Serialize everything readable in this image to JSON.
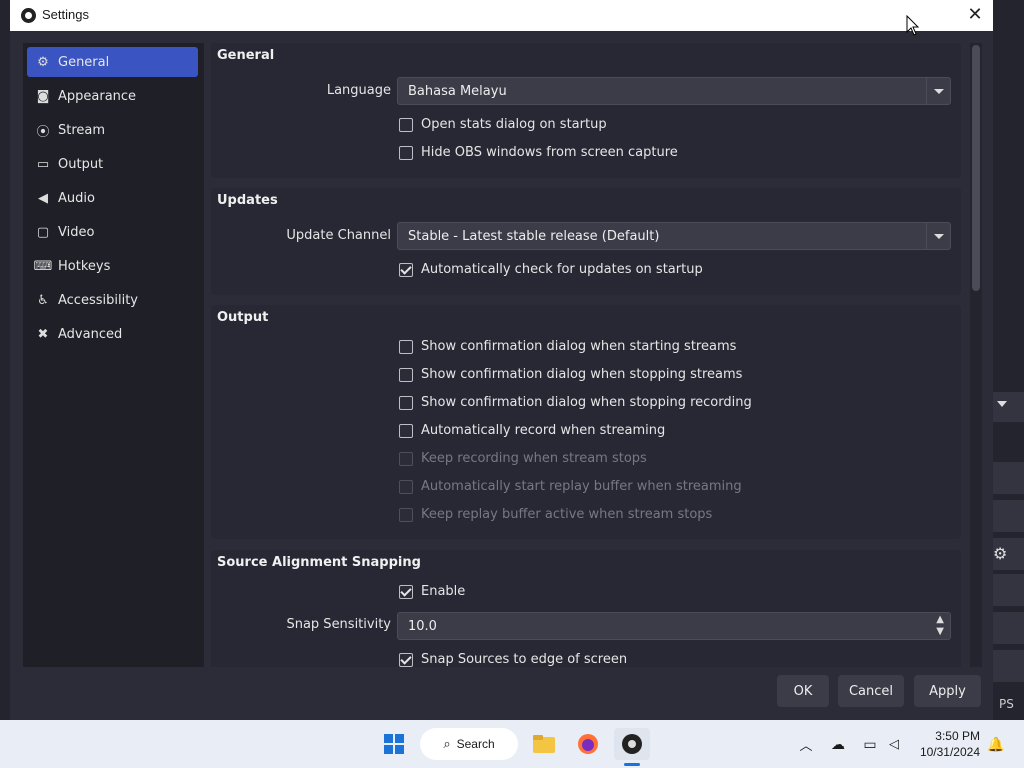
{
  "window": {
    "title": "Settings",
    "close_symbol": "✕"
  },
  "sidebar": {
    "items": [
      {
        "label": "General",
        "icon": "gear-icon",
        "glyph": "⚙"
      },
      {
        "label": "Appearance",
        "icon": "appearance-icon",
        "glyph": "◙"
      },
      {
        "label": "Stream",
        "icon": "broadcast-icon",
        "glyph": "⦿"
      },
      {
        "label": "Output",
        "icon": "output-icon",
        "glyph": "▭"
      },
      {
        "label": "Audio",
        "icon": "speaker-icon",
        "glyph": "◀"
      },
      {
        "label": "Video",
        "icon": "monitor-icon",
        "glyph": "▢"
      },
      {
        "label": "Hotkeys",
        "icon": "keyboard-icon",
        "glyph": "⌨"
      },
      {
        "label": "Accessibility",
        "icon": "accessibility-icon",
        "glyph": "♿"
      },
      {
        "label": "Advanced",
        "icon": "wrench-icon",
        "glyph": "✖"
      }
    ]
  },
  "general": {
    "title": "General",
    "language_label": "Language",
    "language_value": "Bahasa Melayu",
    "open_stats": "Open stats dialog on startup",
    "hide_obs": "Hide OBS windows from screen capture"
  },
  "updates": {
    "title": "Updates",
    "channel_label": "Update Channel",
    "channel_value": "Stable - Latest stable release (Default)",
    "auto_check": "Automatically check for updates on startup"
  },
  "output": {
    "title": "Output",
    "confirm_start": "Show confirmation dialog when starting streams",
    "confirm_stop": "Show confirmation dialog when stopping streams",
    "confirm_stop_rec": "Show confirmation dialog when stopping recording",
    "auto_record": "Automatically record when streaming",
    "keep_recording": "Keep recording when stream stops",
    "auto_replay": "Automatically start replay buffer when streaming",
    "keep_replay": "Keep replay buffer active when stream stops"
  },
  "snapping": {
    "title": "Source Alignment Snapping",
    "enable": "Enable",
    "sensitivity_label": "Snap Sensitivity",
    "sensitivity_value": "10.0",
    "snap_edge": "Snap Sources to edge of screen"
  },
  "buttons": {
    "ok": "OK",
    "cancel": "Cancel",
    "apply": "Apply"
  },
  "taskbar": {
    "search": "Search",
    "time": "3:50 PM",
    "date": "10/31/2024"
  },
  "background": {
    "ps_fragment": "PS"
  },
  "colors": {
    "accent": "#3a55c2",
    "dialog_bg": "#2b2c37",
    "taskbar_bg": "#e9eef6"
  }
}
